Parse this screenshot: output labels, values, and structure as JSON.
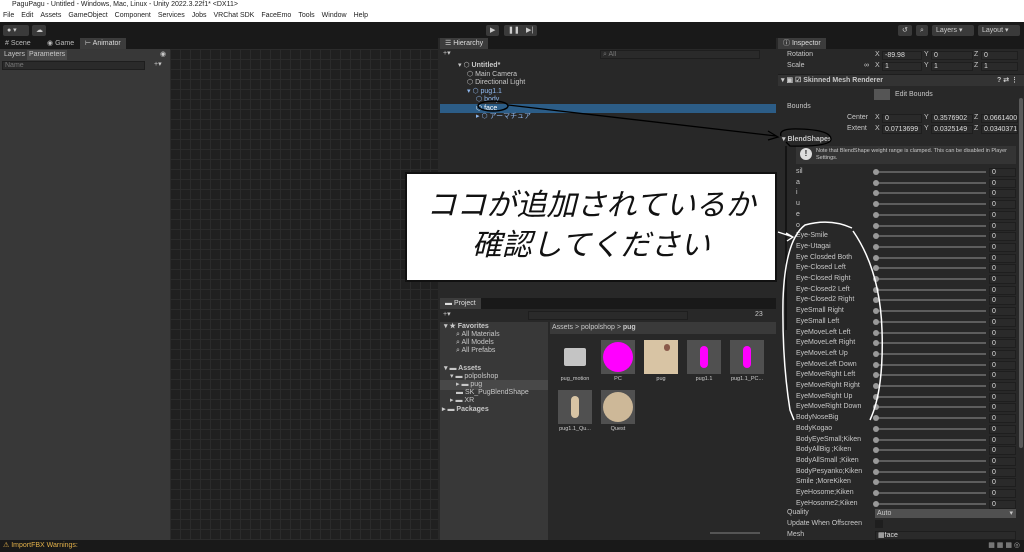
{
  "window": {
    "title": "PaguPagu - Untitled - Windows, Mac, Linux - Unity 2022.3.22f1* <DX11>"
  },
  "menu": [
    "File",
    "Edit",
    "Assets",
    "GameObject",
    "Component",
    "Services",
    "Jobs",
    "VRChat SDK",
    "FaceEmo",
    "Tools",
    "Window",
    "Help"
  ],
  "toolbar": {
    "layers": "Layers",
    "layout": "Layout"
  },
  "left_panel": {
    "tabs": [
      "Scene",
      "Game",
      "Animator"
    ],
    "subtabs": [
      "Layers",
      "Parameters"
    ],
    "search_placeholder": "Name"
  },
  "hierarchy": {
    "title": "Hierarchy",
    "search_placeholder": "All",
    "items": [
      {
        "label": "Untitled*",
        "depth": 0
      },
      {
        "label": "Main Camera",
        "depth": 1
      },
      {
        "label": "Directional Light",
        "depth": 1
      },
      {
        "label": "pug1.1",
        "depth": 1
      },
      {
        "label": "body",
        "depth": 2
      },
      {
        "label": "face",
        "depth": 2,
        "selected": true
      },
      {
        "label": "アーマチュア",
        "depth": 2
      }
    ]
  },
  "project": {
    "title": "Project",
    "hidden_count": "23",
    "favorites": "Favorites",
    "fav_items": [
      "All Materials",
      "All Models",
      "All Prefabs"
    ],
    "assets": "Assets",
    "tree": [
      "polpolshop",
      "pug",
      "SK_PugBlendShape",
      "XR"
    ],
    "packages": "Packages",
    "breadcrumb": [
      "Assets",
      "polpolshop",
      "pug"
    ],
    "tiles": [
      {
        "label": "pug_motion",
        "kind": "folder"
      },
      {
        "label": "PC",
        "kind": "material"
      },
      {
        "label": "pug",
        "kind": "texture"
      },
      {
        "label": "pug1.1",
        "kind": "model"
      },
      {
        "label": "pug1.1_PC...",
        "kind": "model"
      },
      {
        "label": "pug1.1_Qu...",
        "kind": "model2"
      },
      {
        "label": "Quest",
        "kind": "sphere"
      }
    ]
  },
  "inspector": {
    "title": "Inspector",
    "rotation": {
      "label": "Rotation",
      "x": "-89.98",
      "y": "0",
      "z": "0"
    },
    "scale": {
      "label": "Scale",
      "x": "1",
      "y": "1",
      "z": "1"
    },
    "component": "Skinned Mesh Renderer",
    "edit_bounds": "Edit Bounds",
    "bounds": "Bounds",
    "center": {
      "label": "Center",
      "x": "0",
      "y": "0.3576902",
      "z": "0.0661400"
    },
    "extent": {
      "label": "Extent",
      "x": "0.0713699",
      "y": "0.0325149",
      "z": "0.0340371"
    },
    "blendshapes_label": "BlendShapes",
    "note": "Note that BlendShape weight range is clamped. This can be disabled in Player Settings.",
    "blendshapes": [
      {
        "name": "sil",
        "value": 0
      },
      {
        "name": "a",
        "value": 0
      },
      {
        "name": "i",
        "value": 0
      },
      {
        "name": "u",
        "value": 0
      },
      {
        "name": "e",
        "value": 0
      },
      {
        "name": "o",
        "value": 0
      },
      {
        "name": "Eye-Smile",
        "value": 0
      },
      {
        "name": "Eye-Utagai",
        "value": 0
      },
      {
        "name": "Eye Closded Both",
        "value": 0
      },
      {
        "name": "Eye-Closed Left",
        "value": 0
      },
      {
        "name": "Eye-Closed Right",
        "value": 0
      },
      {
        "name": "Eye-Closed2 Left",
        "value": 0
      },
      {
        "name": "Eye-Closed2 Right",
        "value": 0
      },
      {
        "name": "EyeSmall Right",
        "value": 0
      },
      {
        "name": "EyeSmall Left",
        "value": 0
      },
      {
        "name": "EyeMoveLeft Left",
        "value": 0
      },
      {
        "name": "EyeMoveLeft Right",
        "value": 0
      },
      {
        "name": "EyeMoveLeft Up",
        "value": 0
      },
      {
        "name": "EyeMoveLeft Down",
        "value": 0
      },
      {
        "name": "EyeMoveRight Left",
        "value": 0
      },
      {
        "name": "EyeMoveRight Right",
        "value": 0
      },
      {
        "name": "EyeMoveRight Up",
        "value": 0
      },
      {
        "name": "EyeMoveRight Down",
        "value": 0
      },
      {
        "name": "BodyNoseBig",
        "value": 0
      },
      {
        "name": "BodyKogao",
        "value": 0
      },
      {
        "name": "BodyEyeSmall;Kiken",
        "value": 0
      },
      {
        "name": "BodyAllBig ;Kiken",
        "value": 0
      },
      {
        "name": "BodyAllSmall ;Kiken",
        "value": 0
      },
      {
        "name": "BodyPesyanko;Kiken",
        "value": 0
      },
      {
        "name": "Smile ;MoreKiken",
        "value": 0
      },
      {
        "name": "EyeHosome;Kiken",
        "value": 0
      },
      {
        "name": "EyeHosome2;Kiken",
        "value": 0
      }
    ],
    "quality": {
      "label": "Quality",
      "value": "Auto"
    },
    "update_offscreen": "Update When Offscreen",
    "mesh": {
      "label": "Mesh",
      "value": "face"
    }
  },
  "status": {
    "text": "ImportFBX Warnings:"
  },
  "annotation": {
    "line1": "ココが追加されているか",
    "line2": "確認してください"
  },
  "colors": {
    "selection": "#2c5d87",
    "accent": "#4c7fb0",
    "magenta": "#ff00ff"
  }
}
